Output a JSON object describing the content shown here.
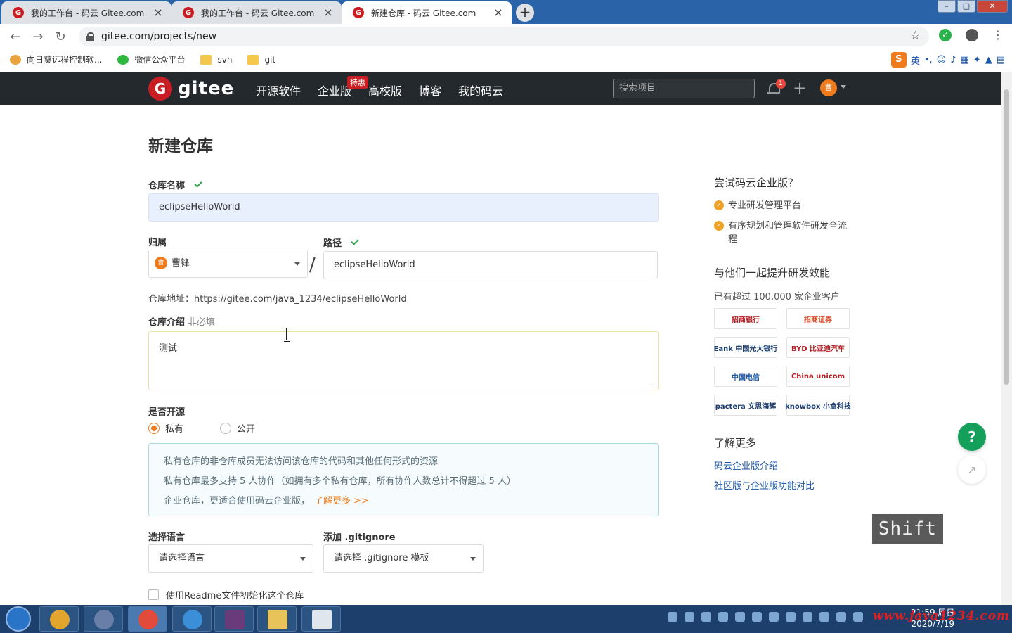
{
  "browser": {
    "tabs": [
      {
        "title": "我的工作台 - 码云 Gitee.com",
        "active": false
      },
      {
        "title": "我的工作台 - 码云 Gitee.com",
        "active": false
      },
      {
        "title": "新建仓库 - 码云 Gitee.com",
        "active": true
      }
    ],
    "url": "gitee.com/projects/new",
    "bookmarks": [
      "向日葵远程控制软...",
      "微信公众平台",
      "svn",
      "git"
    ],
    "ime_label": "英"
  },
  "header": {
    "logo_text": "gitee",
    "nav": [
      "开源软件",
      "企业版",
      "高校版",
      "博客",
      "我的码云"
    ],
    "promo_badge": "特惠",
    "search_placeholder": "搜索项目",
    "notification_count": "1",
    "avatar_initial": "曹"
  },
  "form": {
    "page_title": "新建仓库",
    "repo_name_label": "仓库名称",
    "repo_name_value": "eclipseHelloWorld",
    "owner_label": "归属",
    "owner_value": "曹锋",
    "path_label": "路径",
    "path_value": "eclipseHelloWorld",
    "repo_address": "仓库地址：https://gitee.com/java_1234/eclipseHelloWorld",
    "intro_label": "仓库介绍",
    "intro_optional": "非必填",
    "intro_value": "测试",
    "open_source_label": "是否开源",
    "visibility_options": [
      {
        "label": "私有",
        "selected": true
      },
      {
        "label": "公开",
        "selected": false
      }
    ],
    "info_lines": [
      "私有仓库的非仓库成员无法访问该仓库的代码和其他任何形式的资源",
      "私有仓库最多支持 5 人协作（如拥有多个私有仓库，所有协作人数总计不得超过 5 人）",
      "企业仓库，更适合使用码云企业版，"
    ],
    "info_more_link": "了解更多 >>",
    "language_label": "选择语言",
    "language_value": "请选择语言",
    "gitignore_label": "添加 .gitignore",
    "gitignore_value": "请选择 .gitignore 模板",
    "readme_label": "使用Readme文件初始化这个仓库"
  },
  "sidebar": {
    "try_title": "尝试码云企业版？",
    "features": [
      "专业研发管理平台",
      "有序规划和管理软件研发全流程"
    ],
    "together_title": "与他们一起提升研发效能",
    "customers_text": "已有超过 100,000 家企业客户",
    "logos": [
      "招商银行",
      "招商证券",
      "Eank 中国光大银行",
      "BYD 比亚迪汽车",
      "中国电信",
      "China unicom",
      "pactera 文思海辉",
      "knowbox 小盒科技"
    ],
    "learn_more_title": "了解更多",
    "links": [
      "码云企业版介绍",
      "社区版与企业版功能对比"
    ]
  },
  "floating": {
    "help_label": "?",
    "key_overlay": "Shift"
  },
  "taskbar": {
    "time": "21:59 周日",
    "date": "2020/7/19",
    "watermark": "www.java1234.com"
  }
}
